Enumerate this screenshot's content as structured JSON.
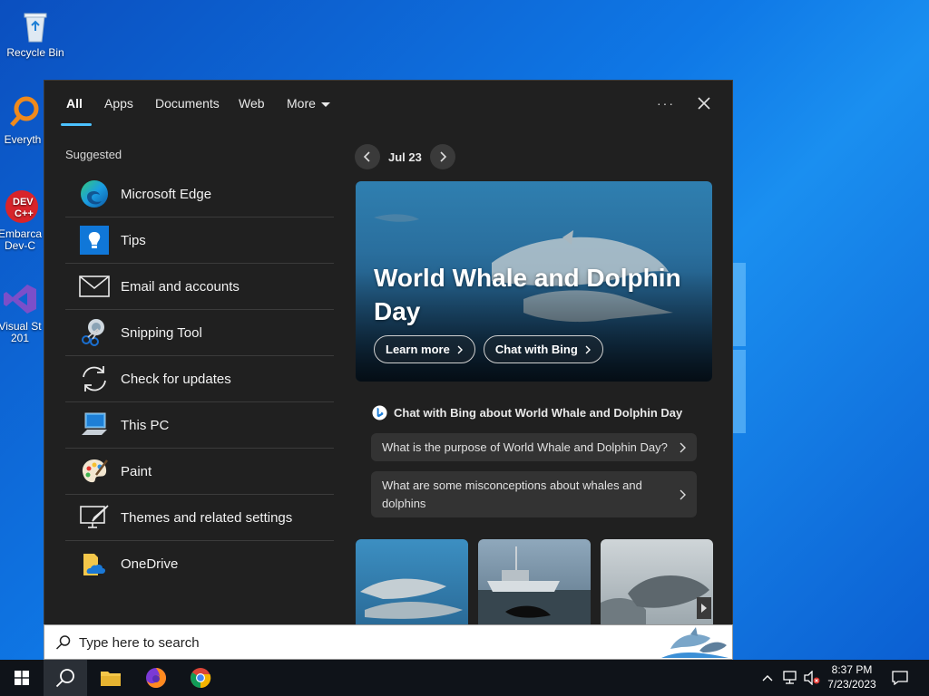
{
  "desktop": {
    "icons": [
      {
        "label": "Recycle Bin"
      },
      {
        "label": "Everyth"
      },
      {
        "label": "Embarca Dev-C"
      },
      {
        "label": "Visual St 201"
      }
    ]
  },
  "search_panel": {
    "tabs": [
      {
        "label": "All",
        "active": true
      },
      {
        "label": "Apps"
      },
      {
        "label": "Documents"
      },
      {
        "label": "Web"
      },
      {
        "label": "More"
      }
    ],
    "suggested_title": "Suggested",
    "apps": [
      {
        "label": "Microsoft Edge",
        "icon": "edge-icon"
      },
      {
        "label": "Tips",
        "icon": "tips-icon"
      },
      {
        "label": "Email and accounts",
        "icon": "mail-icon"
      },
      {
        "label": "Snipping Tool",
        "icon": "snipping-tool-icon"
      },
      {
        "label": "Check for updates",
        "icon": "sync-icon"
      },
      {
        "label": "This PC",
        "icon": "this-pc-icon"
      },
      {
        "label": "Paint",
        "icon": "paint-icon"
      },
      {
        "label": "Themes and related settings",
        "icon": "themes-icon"
      },
      {
        "label": "OneDrive",
        "icon": "onedrive-icon"
      }
    ],
    "date_label": "Jul 23",
    "hero": {
      "title": "World Whale and Dolphin Day",
      "learn_more": "Learn more",
      "chat_with_bing": "Chat with Bing"
    },
    "chat_heading": "Chat with Bing about World Whale and Dolphin Day",
    "questions": [
      "What is the purpose of World Whale and Dolphin Day?",
      "What are some misconceptions about whales and dolphins"
    ]
  },
  "search_box": {
    "placeholder": "Type here to search"
  },
  "taskbar": {
    "clock_time": "8:37 PM",
    "clock_date": "7/23/2023"
  },
  "colors": {
    "accent": "#4cc2ff",
    "panel_bg": "#202020",
    "taskbar_bg": "#0f1319"
  }
}
